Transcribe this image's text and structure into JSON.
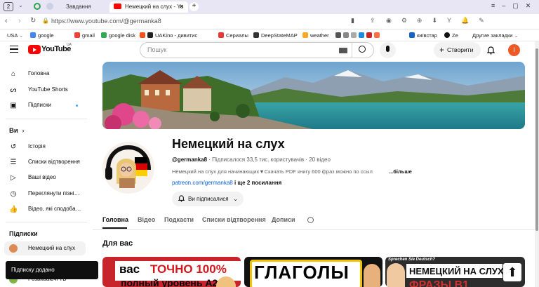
{
  "browser": {
    "tab_count": "2",
    "tabs": [
      {
        "label": "Завдання"
      },
      {
        "label": "Немецкий на слух - Yo"
      }
    ],
    "url": "https://www.youtube.com/@germanka8",
    "bookmarks": [
      {
        "label": "USA"
      },
      {
        "label": "google"
      },
      {
        "label": "gmail"
      },
      {
        "label": "google disk"
      },
      {
        "label": "UAKino - дивитис"
      },
      {
        "label": "Сериалы"
      },
      {
        "label": "DeepStateMAP"
      },
      {
        "label": "weather"
      },
      {
        "label": "київстар"
      },
      {
        "label": "Ze"
      },
      {
        "label": "Другие закладки"
      }
    ]
  },
  "youtube": {
    "logo_text": "YouTube",
    "logo_region": "UA",
    "search_placeholder": "Пошук",
    "create_label": "Створити",
    "avatar_letter": "I",
    "sidebar": {
      "main": [
        {
          "label": "Головна",
          "icon": "home-icon"
        },
        {
          "label": "YouTube Shorts",
          "icon": "shorts-icon"
        },
        {
          "label": "Підписки",
          "icon": "subscriptions-icon"
        }
      ],
      "you_title": "Ви",
      "you": [
        {
          "label": "Історія",
          "icon": "history-icon"
        },
        {
          "label": "Списки відтворення",
          "icon": "playlists-icon"
        },
        {
          "label": "Ваші відео",
          "icon": "your-videos-icon"
        },
        {
          "label": "Переглянути пізні…",
          "icon": "watch-later-icon"
        },
        {
          "label": "Відео, які сподоба…",
          "icon": "liked-icon"
        }
      ],
      "subs_title": "Підписки",
      "subs": [
        {
          "label": "Немецкий на слух"
        },
        {
          "label": "Розвиваючі ТБ"
        }
      ]
    },
    "channel": {
      "name": "Немецкий на слух",
      "handle": "@germanka8",
      "subscribers": "Підписалося 33,5 тис. користувачів",
      "videos": "20 відео",
      "description": "Немецкий на слух для начинающих▼Скачать PDF книгу 600 фраз можно по ссыл",
      "more": "...більше",
      "link": "patreon.com/germanka8",
      "links_more": "і ще 2 посилання",
      "subscribed_label": "Ви підписалися"
    },
    "tabs": [
      "Головна",
      "Відео",
      "Подкасти",
      "Списки відтворення",
      "Дописи"
    ],
    "section_title": "Для вас",
    "thumbnails": [
      {
        "line1a": "вас",
        "line1b": "ТОЧНО 100%",
        "line2": "полный уровень А2"
      },
      {
        "line1": "ГЛАГОЛЫ"
      },
      {
        "top": "Sprechen Sie Deutsch?",
        "line1": "НЕМЕЦКИЙ НА СЛУХ",
        "line2": "ФРАЗЫ В1"
      }
    ],
    "toast": "Підписку додано",
    "colors": {
      "brand_red": "#ff0000",
      "accent_orange": "#ef5a24",
      "notify_dot": "#3ea6ff"
    }
  }
}
